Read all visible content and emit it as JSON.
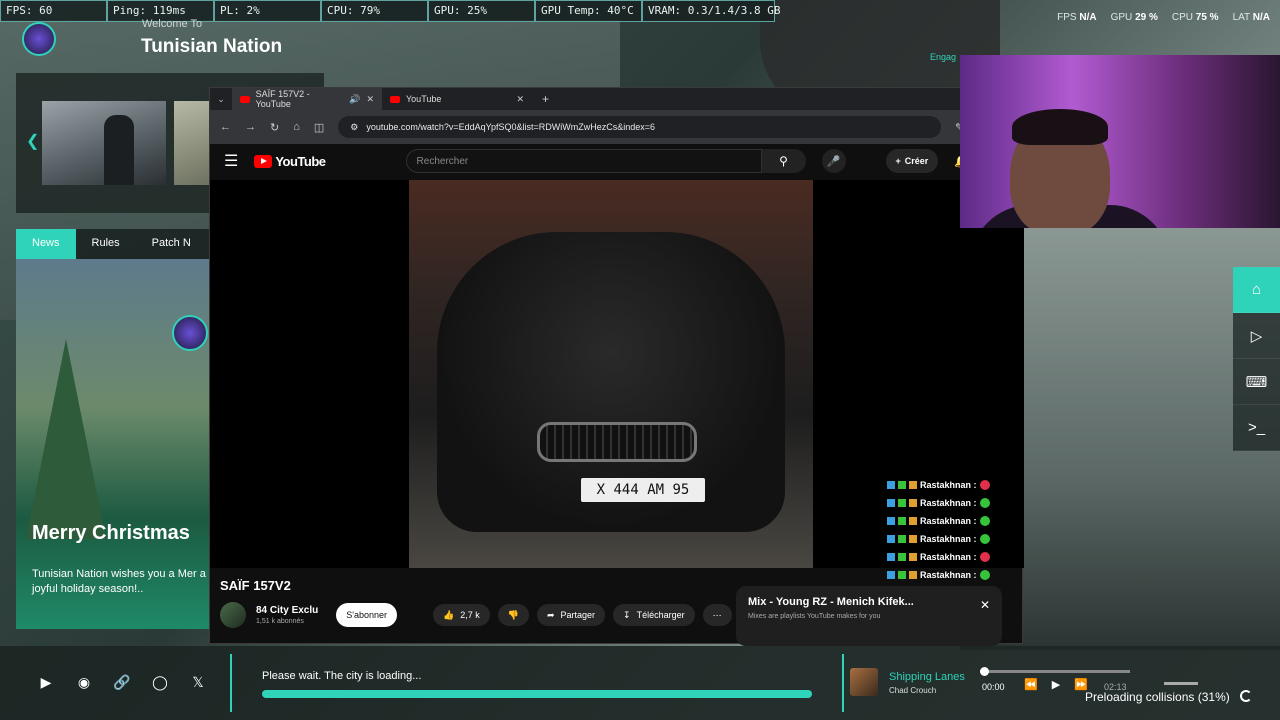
{
  "perf_overlay": {
    "fps": "FPS: 60",
    "ping": "Ping: 119ms",
    "pl": "PL: 2%",
    "cpu": "CPU: 79%",
    "gpu": "GPU: 25%",
    "gpu_temp": "GPU Temp: 40°C",
    "vram": "VRAM: 0.3/1.4/3.8 GB"
  },
  "perf_right": {
    "fps_label": "FPS",
    "fps_value": "N/A",
    "gpu_label": "GPU",
    "gpu_value": "29 %",
    "cpu_label": "CPU",
    "cpu_value": "75 %",
    "lat_label": "LAT",
    "lat_value": "N/A"
  },
  "server": {
    "welcome": "Welcome To",
    "name": "Tunisian Nation",
    "tabs": [
      "News",
      "Rules",
      "Patch N"
    ],
    "news_title": "Merry Christmas",
    "news_body": "Tunisian Nation wishes you a Mer a joyful holiday season!.."
  },
  "engage": "Engag",
  "browser": {
    "tabs": [
      {
        "title": "SAÏF 157V2 - YouTube"
      },
      {
        "title": "YouTube"
      }
    ],
    "url": "youtube.com/watch?v=EddAqYpfSQ0&list=RDWiWmZwHezCs&index=6"
  },
  "youtube": {
    "logo": "YouTube",
    "search_placeholder": "Rechercher",
    "create_label": "Créer",
    "plate": "X 444 AM 95",
    "chat": [
      {
        "user": "Rastakhnan :",
        "emote_color": "#e0304a"
      },
      {
        "user": "Rastakhnan :",
        "emote_color": "#38c43a"
      },
      {
        "user": "Rastakhnan :",
        "emote_color": "#38c43a"
      },
      {
        "user": "Rastakhnan :",
        "emote_color": "#38c43a"
      },
      {
        "user": "Rastakhnan :",
        "emote_color": "#e0304a"
      },
      {
        "user": "Rastakhnan :",
        "emote_color": "#38c43a"
      }
    ],
    "video_title": "SAÏF 157V2",
    "channel_name": "84 City Exclu",
    "channel_subs": "1,51 k abonnés",
    "subscribe_label": "S'abonner",
    "like_count": "2,7 k",
    "share_label": "Partager",
    "download_label": "Télécharger",
    "mix_title": "Mix - Young RZ - Menich Kifek...",
    "mix_sub": "Mixes are playlists YouTube makes for you"
  },
  "bottom": {
    "loading_text": "Please wait. The city is loading...",
    "loading_progress": 1.0,
    "track_title": "Shipping Lanes",
    "track_artist": "Chad Crouch",
    "time_current": "00:00",
    "time_total": "02:13",
    "preload": "Preloading collisions (31%)"
  },
  "colors": {
    "accent": "#2fd3b9",
    "youtube_red": "#ff0000"
  }
}
